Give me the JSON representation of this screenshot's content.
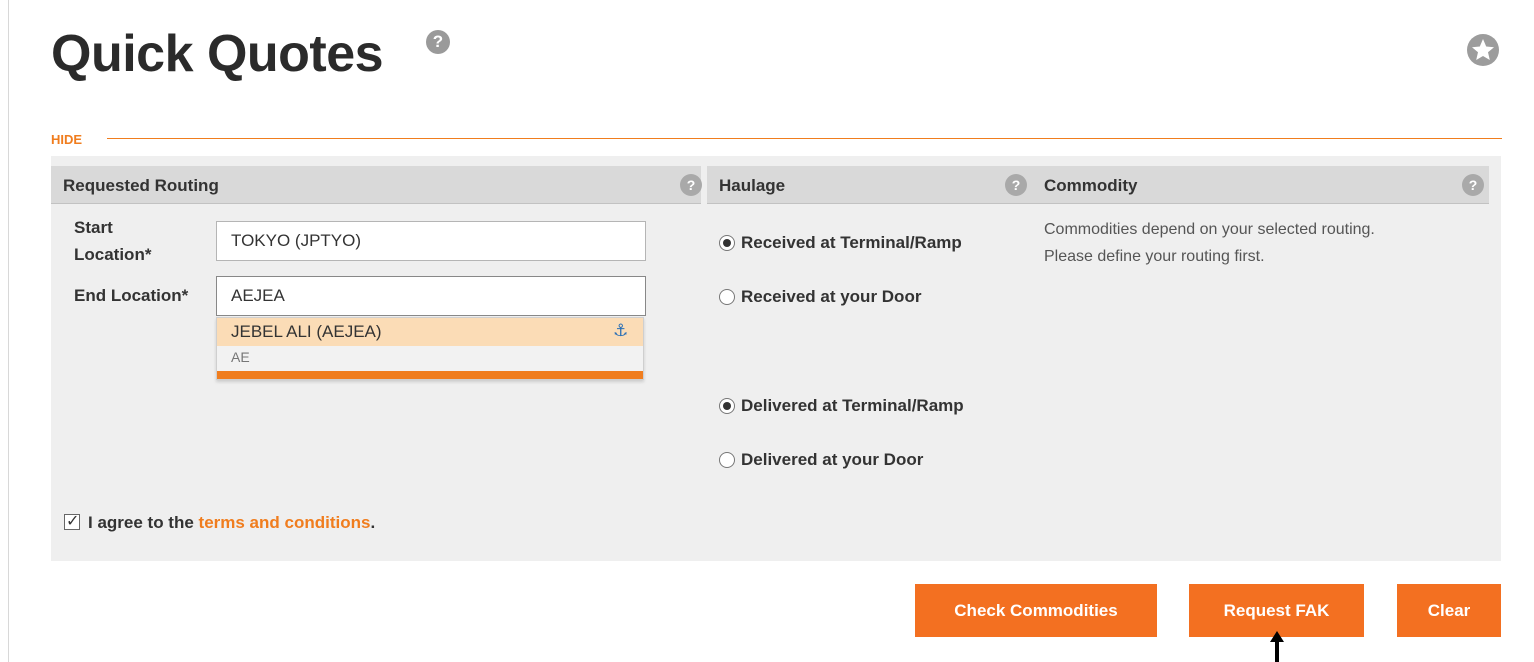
{
  "page": {
    "title": "Quick Quotes",
    "help_glyph": "?",
    "hide_label": "HIDE"
  },
  "routing": {
    "header": "Requested Routing",
    "start_label_line1": "Start",
    "start_label_line2": "Location*",
    "start_value": "TOKYO (JPTYO)",
    "end_label": "End Location*",
    "end_value": "AEJEA",
    "suggestion": {
      "name": "JEBEL ALI (AEJEA)",
      "country": "AE",
      "icon": "anchor-icon",
      "icon_glyph": "⚓"
    }
  },
  "haulage": {
    "header": "Haulage",
    "receipt_options": [
      {
        "label": "Received at Terminal/Ramp",
        "checked": true
      },
      {
        "label": "Received at your Door",
        "checked": false
      }
    ],
    "delivery_options": [
      {
        "label": "Delivered at Terminal/Ramp",
        "checked": true
      },
      {
        "label": "Delivered at your Door",
        "checked": false
      }
    ]
  },
  "commodity": {
    "header": "Commodity",
    "note_line1": "Commodities depend on your selected routing.",
    "note_line2": "Please define your routing first."
  },
  "agreement": {
    "checked": true,
    "text_before": "I agree to the ",
    "link_text": "terms and conditions",
    "text_after": "."
  },
  "buttons": {
    "check_commodities": "Check Commodities",
    "request_fak": "Request FAK",
    "clear": "Clear"
  },
  "colors": {
    "accent": "#f37021",
    "highlight": "#fbdcb6",
    "panel_bg": "#efefef",
    "header_bg": "#d9d9d9"
  }
}
